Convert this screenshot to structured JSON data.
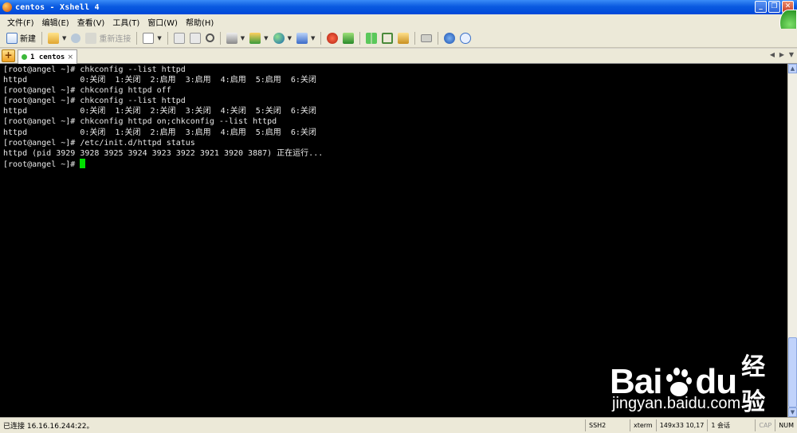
{
  "window": {
    "title": "centos - Xshell 4",
    "controls": [
      "_",
      "❐",
      "✕"
    ]
  },
  "menu": [
    "文件(F)",
    "编辑(E)",
    "查看(V)",
    "工具(T)",
    "窗口(W)",
    "帮助(H)"
  ],
  "toolbar": {
    "new_label": "新建",
    "reconnect_label": "重新连接"
  },
  "tabs": {
    "add_symbol": "+",
    "active_label": "1 centos",
    "close_symbol": "×"
  },
  "terminal": {
    "lines": [
      "[root@angel ~]# chkconfig --list httpd",
      "httpd           0:关闭  1:关闭  2:启用  3:启用  4:启用  5:启用  6:关闭",
      "[root@angel ~]# chkconfig httpd off",
      "[root@angel ~]# chkconfig --list httpd",
      "httpd           0:关闭  1:关闭  2:关闭  3:关闭  4:关闭  5:关闭  6:关闭",
      "[root@angel ~]# chkconfig httpd on;chkconfig --list httpd",
      "httpd           0:关闭  1:关闭  2:启用  3:启用  4:启用  5:启用  6:关闭",
      "[root@angel ~]# /etc/init.d/httpd status",
      "httpd (pid 3929 3928 3925 3924 3923 3922 3921 3920 3887) 正在运行..."
    ],
    "prompt": "[root@angel ~]# ",
    "cursor_color": "#00e000"
  },
  "watermark": {
    "brand_left": "Bai",
    "brand_right": "du",
    "brand_cn": "经验",
    "url": "jingyan.baidu.com"
  },
  "status": {
    "connection": "已连接 16.16.16.244:22。",
    "protocol": "SSH2",
    "term_type": "xterm",
    "size_pos": "149x33  10,17",
    "sessions": "1 会话",
    "cap": "CAP",
    "num": "NUM"
  }
}
